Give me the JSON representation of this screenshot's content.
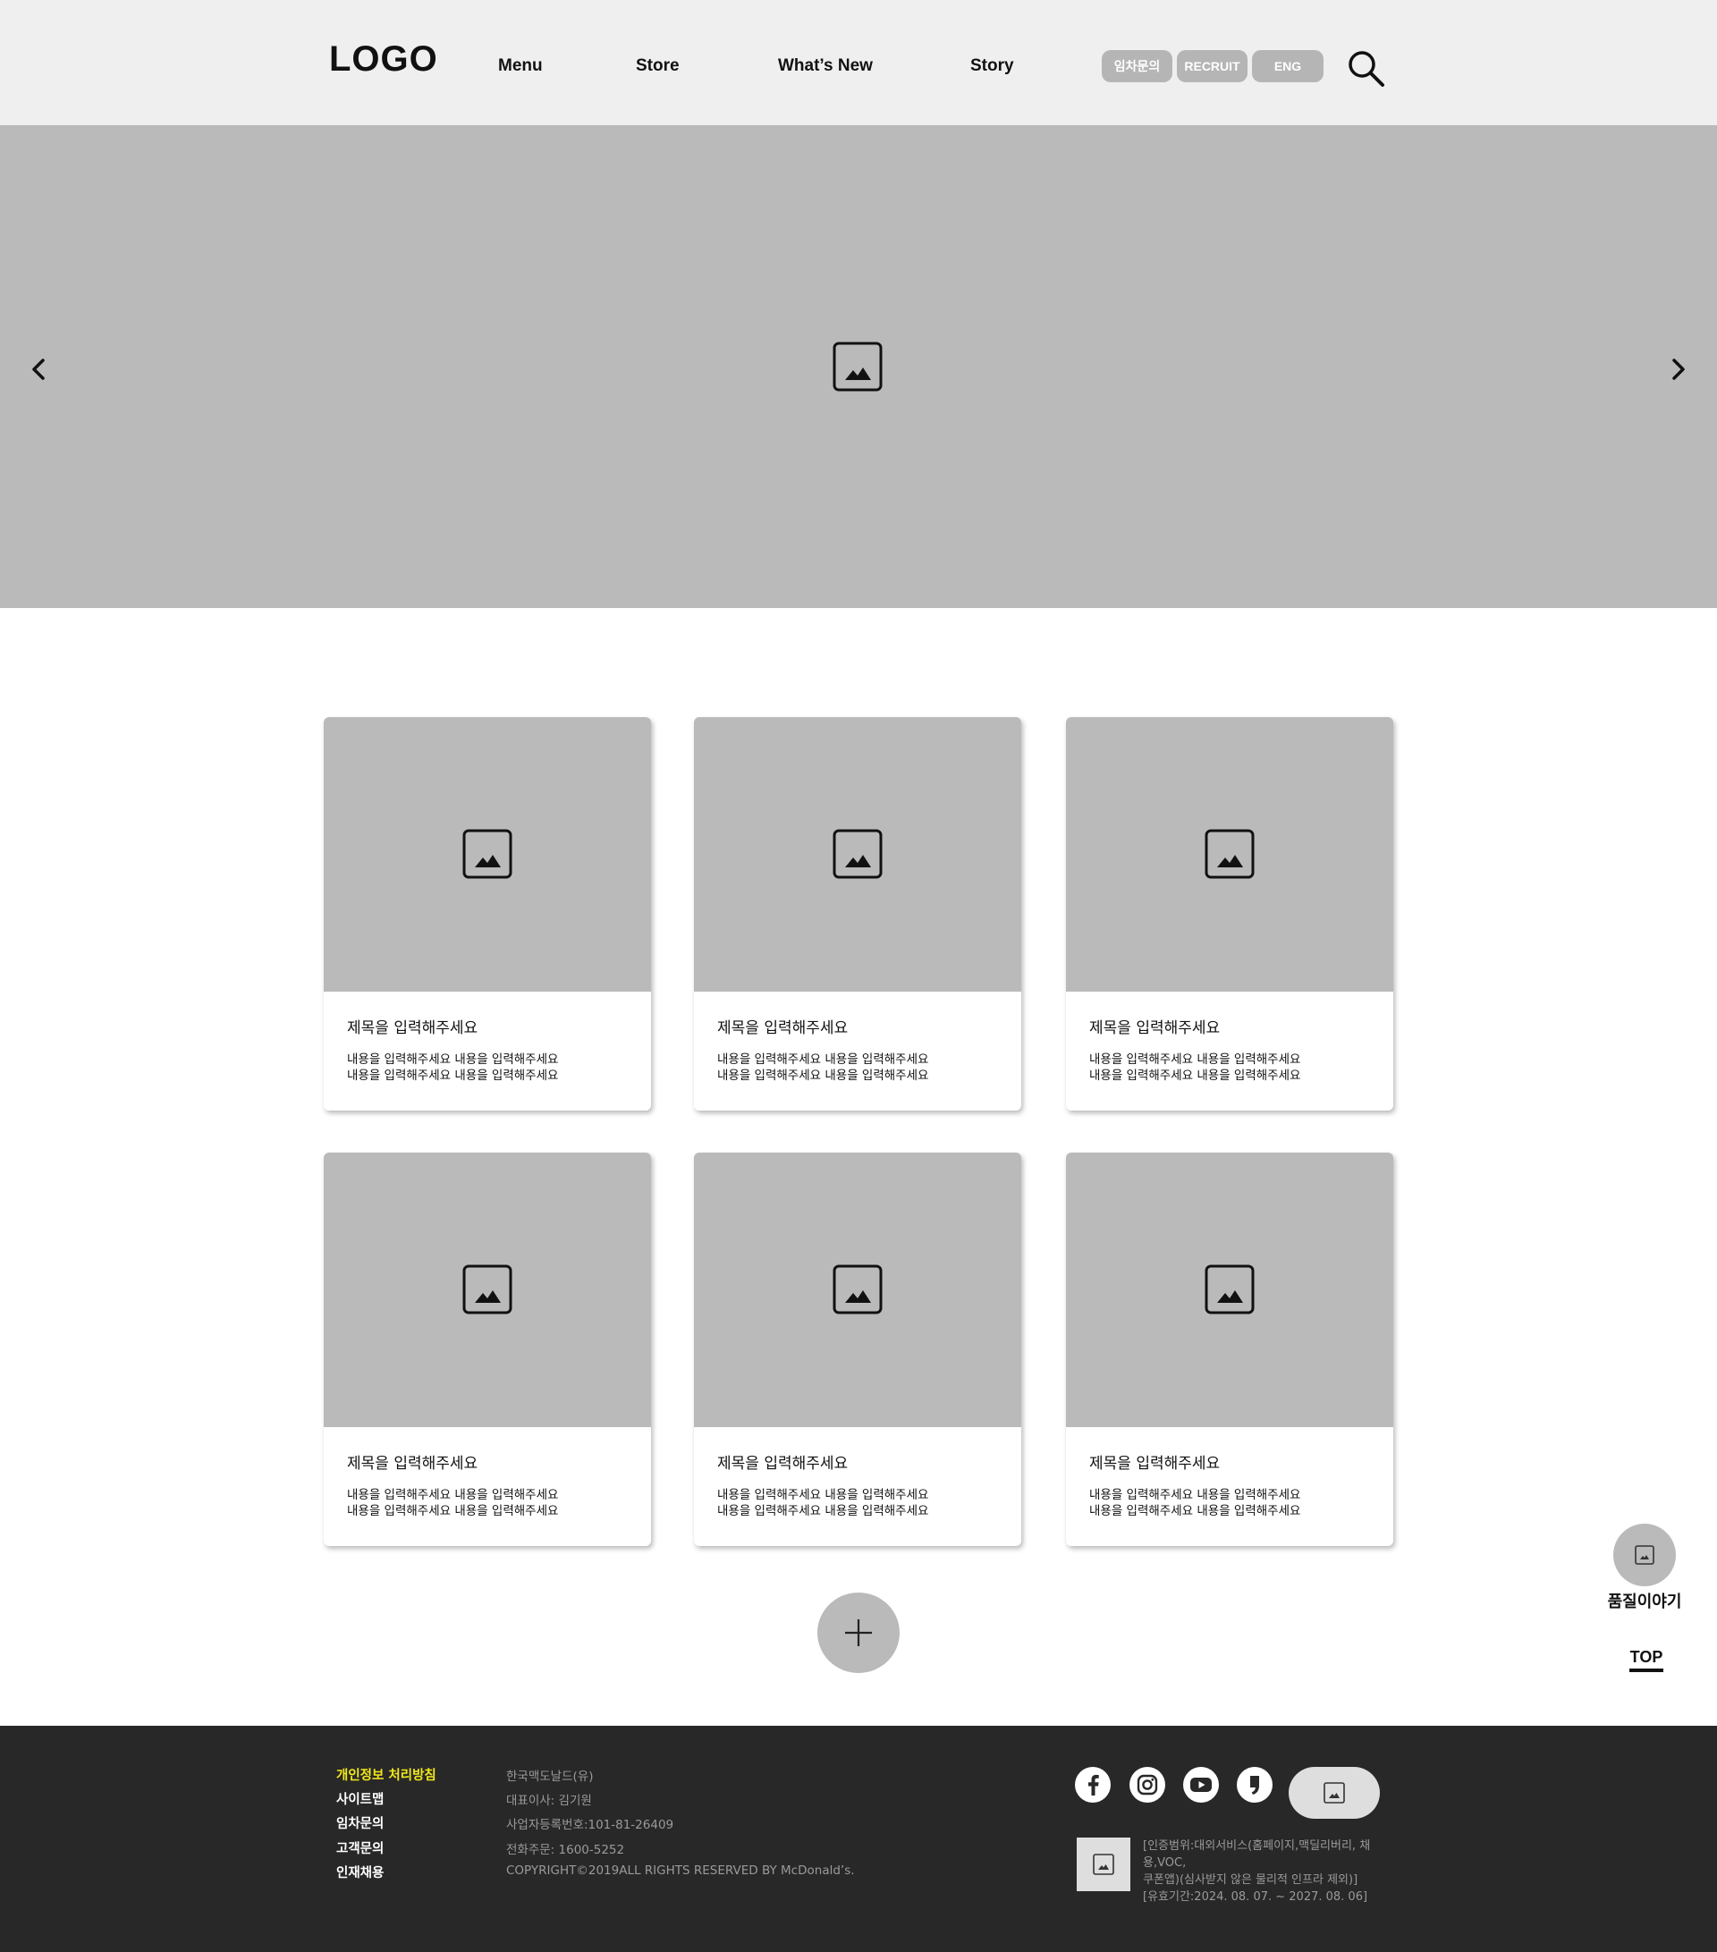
{
  "header": {
    "logo": "LOGO",
    "nav": [
      "Menu",
      "Store",
      "What’s New",
      "Story"
    ],
    "pills": [
      "임차문의",
      "RECRUIT",
      "ENG"
    ]
  },
  "hero": {
    "image_icon": "image-placeholder-icon",
    "prev_icon": "chevron-left-icon",
    "next_icon": "chevron-right-icon"
  },
  "cards": [
    {
      "title": "제목을 입력해주세요",
      "body": [
        "내용을 입력해주세요 내용을 입력해주세요",
        "내용을 입력해주세요 내용을 입력해주세요"
      ]
    },
    {
      "title": "제목을 입력해주세요",
      "body": [
        "내용을 입력해주세요 내용을 입력해주세요",
        "내용을 입력해주세요 내용을 입력해주세요"
      ]
    },
    {
      "title": "제목을 입력해주세요",
      "body": [
        "내용을 입력해주세요 내용을 입력해주세요",
        "내용을 입력해주세요 내용을 입력해주세요"
      ]
    },
    {
      "title": "제목을 입력해주세요",
      "body": [
        "내용을 입력해주세요 내용을 입력해주세요",
        "내용을 입력해주세요 내용을 입력해주세요"
      ]
    },
    {
      "title": "제목을 입력해주세요",
      "body": [
        "내용을 입력해주세요 내용을 입력해주세요",
        "내용을 입력해주세요 내용을 입력해주세요"
      ]
    },
    {
      "title": "제목을 입력해주세요",
      "body": [
        "내용을 입력해주세요 내용을 입력해주세요",
        "내용을 입력해주세요 내용을 입력해주세요"
      ]
    }
  ],
  "more_button_icon": "plus-icon",
  "floating": {
    "label": "품질이야기",
    "top_label": "TOP"
  },
  "footer": {
    "links": [
      "개인정보 처리방침",
      "사이트맵",
      "임차문의",
      "고객문의",
      "인재채용"
    ],
    "info": [
      "한국맥도날드(유)",
      "대표이사: 김기원",
      "사업자등록번호:101-81-26409",
      "전화주문: 1600-5252",
      "COPYRIGHT©2019ALL RIGHTS RESERVED BY McDonald’s."
    ],
    "social_icons": [
      "facebook-icon",
      "instagram-icon",
      "youtube-icon",
      "blog-icon"
    ],
    "cert_text_1": "[인증범위:대외서비스(홈페이지,맥딜리버리, 채용,VOC,",
    "cert_text_2": "쿠폰앱)(심사받지 않은 물리적 인프라 제외)]",
    "cert_valid": "[유효기간:2024. 08. 07. ~ 2027. 08. 06]"
  },
  "colors": {
    "header_bg": "#efefef",
    "placeholder_gray": "#bababa",
    "footer_bg": "#282828",
    "accent_yellow": "#f2e81c"
  }
}
